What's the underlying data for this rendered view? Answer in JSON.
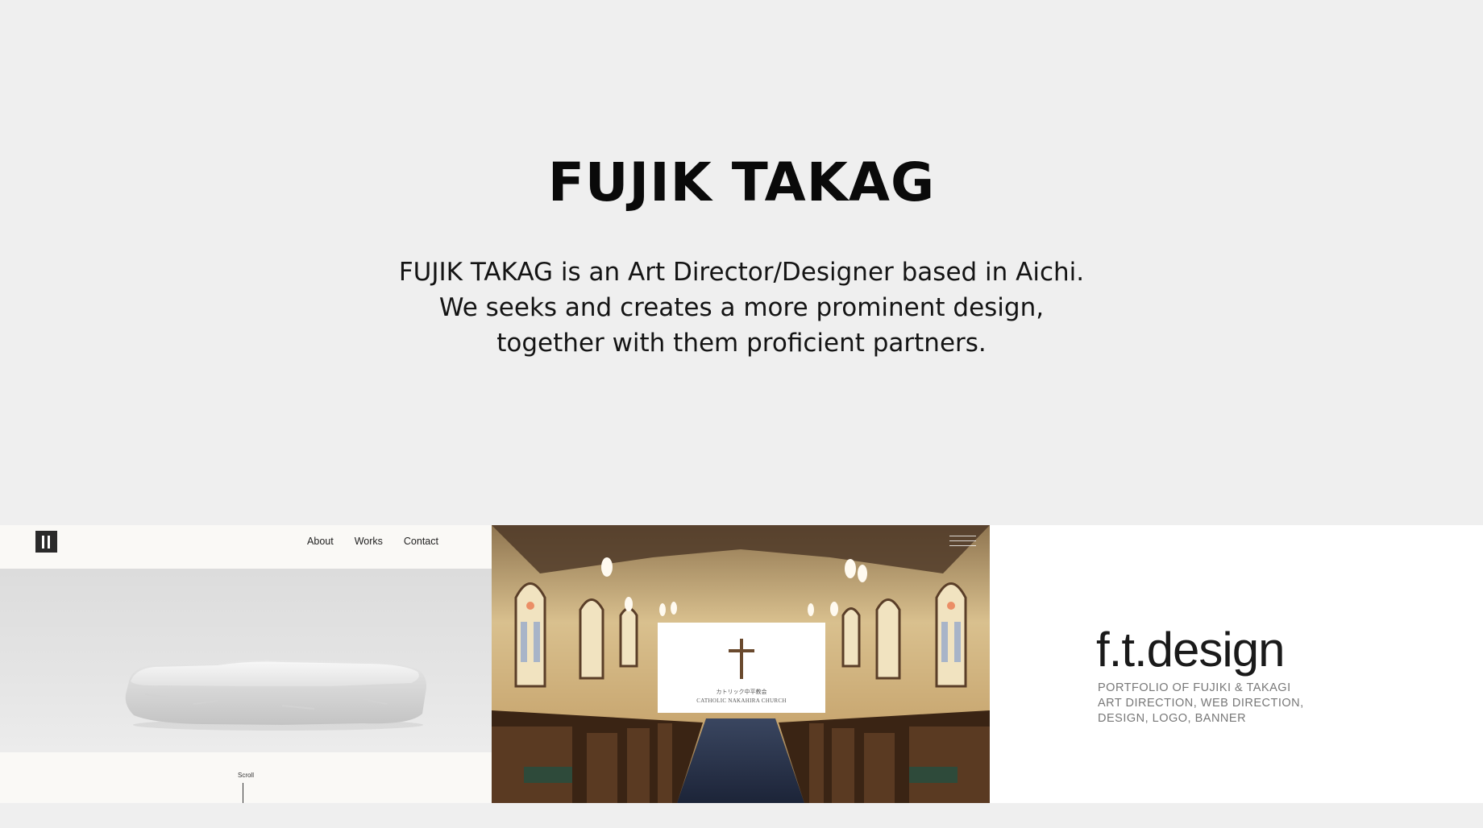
{
  "hero": {
    "title": "FUJIK TAKAG",
    "description_lines": [
      "FUJIK TAKAG is an Art Director/Designer based in Aichi.",
      "We seeks and creates a more prominent design,",
      "together with them proficient partners."
    ]
  },
  "works": [
    {
      "nav": [
        "About",
        "Works",
        "Contact"
      ],
      "scroll_label": "Scroll",
      "logo_icon": "ft-logo-icon"
    },
    {
      "sign_jp": "カトリック中平教会",
      "sign_en": "CATHOLIC NAKAHIRA CHURCH",
      "menu_icon": "hamburger-menu-icon"
    },
    {
      "title": "f.t.design",
      "lines": [
        "PORTFOLIO OF FUJIKI & TAKAGI",
        "ART DIRECTION, WEB DIRECTION,",
        "DESIGN, LOGO, BANNER"
      ]
    }
  ],
  "colors": {
    "background": "#efefef",
    "text": "#111111"
  }
}
